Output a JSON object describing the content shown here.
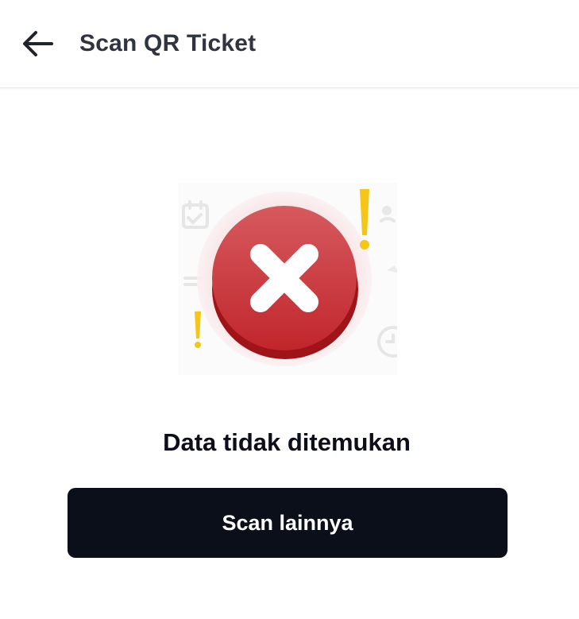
{
  "header": {
    "title": "Scan QR Ticket",
    "back_icon": "arrow-left-icon"
  },
  "result": {
    "icon": "error-x-icon",
    "message": "Data tidak ditemukan"
  },
  "actions": {
    "scan_again_label": "Scan lainnya"
  },
  "colors": {
    "primary_button": "#0a0f1a",
    "error_red": "#c8333a",
    "warning_yellow": "#f5c518",
    "title_text": "#2f3440"
  }
}
